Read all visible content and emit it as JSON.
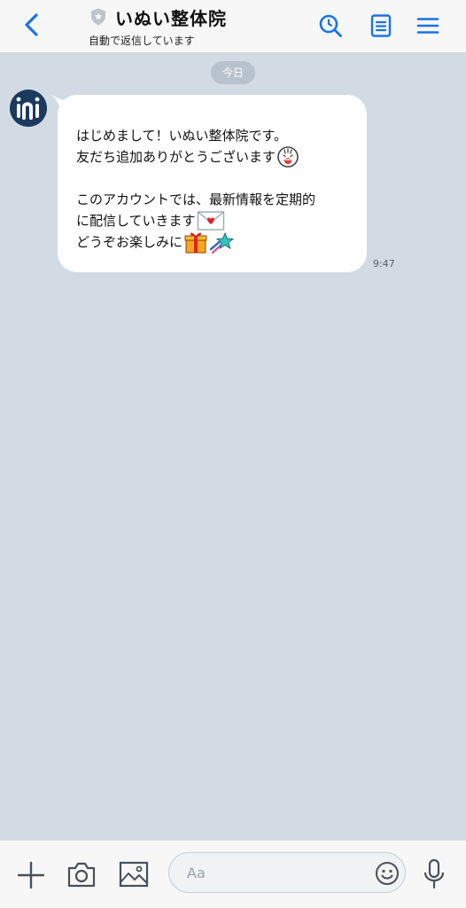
{
  "header": {
    "title": "いぬい整体院",
    "subtitle": "自動で返信しています"
  },
  "chat": {
    "date_label": "今日",
    "message": {
      "lines": [
        "はじめまして！いぬい整体院です。",
        "友だち追加ありがとうございます",
        "",
        "このアカウントでは、最新情報を定期的",
        "に配信していきます",
        "どうぞお楽しみに"
      ],
      "emojis": [
        "laughing-face-emoji",
        "love-letter-emoji",
        "gift-emoji",
        "shooting-star-emoji"
      ],
      "time": "9:47"
    }
  },
  "input": {
    "placeholder": "Aa"
  },
  "colors": {
    "accent": "#1a73e8",
    "chat_background": "#d2dbe4",
    "bubble": "#ffffff",
    "avatar": "#1c3a5e"
  }
}
